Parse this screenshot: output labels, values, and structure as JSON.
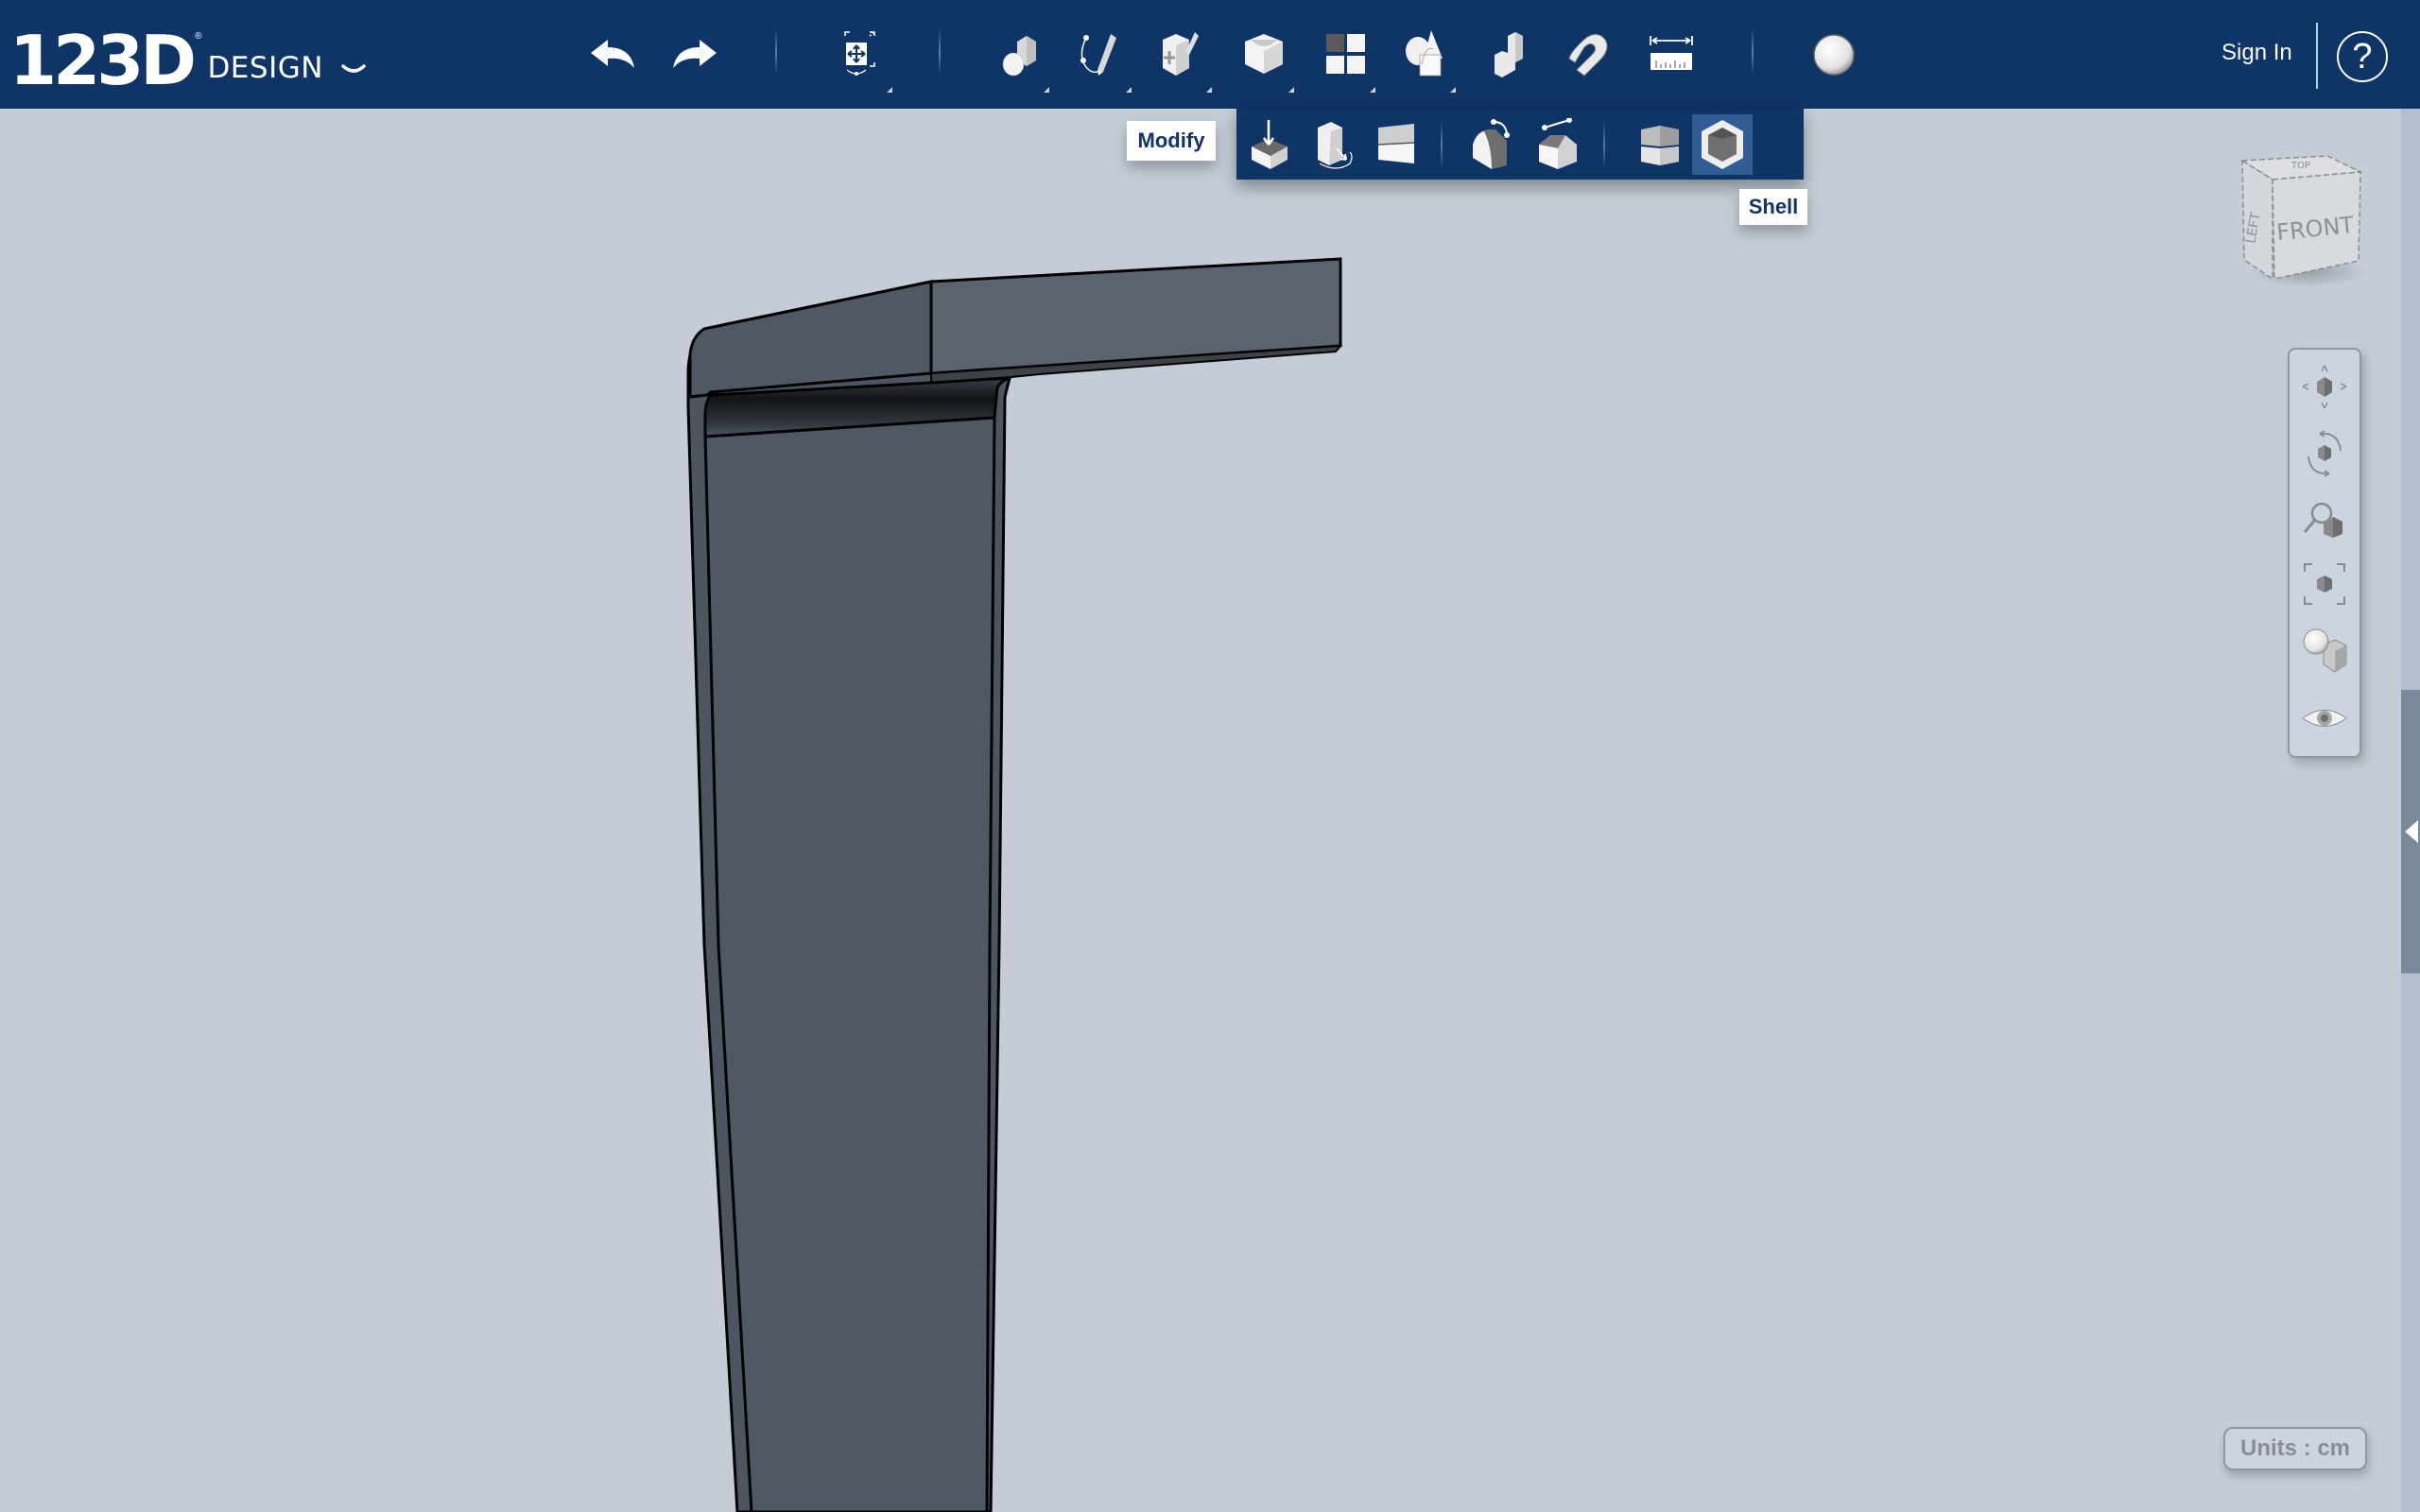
{
  "app": {
    "logo_number": "123D",
    "logo_registered": "®",
    "logo_word": "DESIGN",
    "logo_menu_icon": "chevron-down-icon"
  },
  "toolbar": {
    "items": [
      {
        "id": "undo",
        "icon": "undo-arrow-icon",
        "has_submenu": false
      },
      {
        "id": "redo",
        "icon": "redo-arrow-icon",
        "has_submenu": false
      },
      {
        "id": "transform",
        "icon": "transform-move-icon",
        "has_submenu": true
      },
      {
        "id": "primitives",
        "icon": "primitives-icon",
        "has_submenu": true
      },
      {
        "id": "sketch",
        "icon": "sketch-icon",
        "has_submenu": true
      },
      {
        "id": "construct",
        "icon": "construct-icon",
        "has_submenu": true
      },
      {
        "id": "modify",
        "icon": "modify-icon",
        "has_submenu": true,
        "active": true
      },
      {
        "id": "pattern",
        "icon": "pattern-icon",
        "has_submenu": true
      },
      {
        "id": "grouping",
        "icon": "grouping-icon",
        "has_submenu": true
      },
      {
        "id": "combine",
        "icon": "combine-icon",
        "has_submenu": false
      },
      {
        "id": "snap",
        "icon": "snap-magnet-icon",
        "has_submenu": false
      },
      {
        "id": "measure",
        "icon": "measure-ruler-icon",
        "has_submenu": false
      },
      {
        "id": "material",
        "icon": "material-sphere-icon",
        "has_submenu": false
      }
    ],
    "sign_in_label": "Sign In",
    "help_label": "?"
  },
  "modify_menu": {
    "tooltip": "Modify",
    "items": [
      {
        "id": "press-pull",
        "icon": "press-pull-icon"
      },
      {
        "id": "tweak",
        "icon": "tweak-icon"
      },
      {
        "id": "split-face",
        "icon": "split-face-icon"
      },
      {
        "id": "fillet",
        "icon": "fillet-icon"
      },
      {
        "id": "chamfer",
        "icon": "chamfer-icon"
      },
      {
        "id": "split-solid",
        "icon": "split-solid-icon"
      },
      {
        "id": "shell",
        "icon": "shell-icon",
        "active": true
      }
    ],
    "hover_tooltip": "Shell"
  },
  "viewcube": {
    "front_label": "FRONT",
    "left_label": "LEFT",
    "top_label": "TOP"
  },
  "navigation": {
    "items": [
      {
        "id": "pan",
        "icon": "pan-icon"
      },
      {
        "id": "orbit",
        "icon": "orbit-icon"
      },
      {
        "id": "zoom",
        "icon": "zoom-icon"
      },
      {
        "id": "fit",
        "icon": "fit-to-view-icon"
      },
      {
        "id": "materials-outlines",
        "icon": "materials-outlines-icon"
      },
      {
        "id": "visibility",
        "icon": "eye-icon"
      }
    ]
  },
  "status": {
    "units_label": "Units : cm"
  },
  "colors": {
    "toolbar_bg": "#0f3466",
    "viewport_bg": "#c5ccd6",
    "model_face": "#505864",
    "active_item": "#2f5d94"
  }
}
